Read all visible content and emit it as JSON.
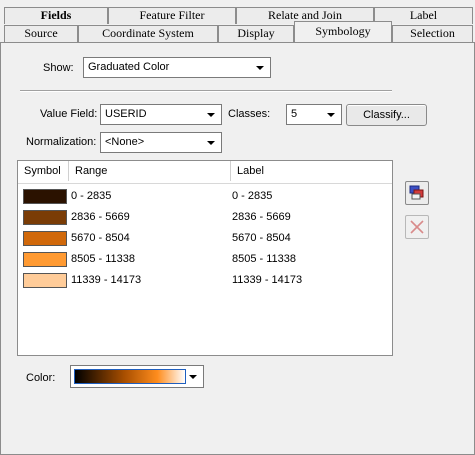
{
  "tabs_top": [
    "Fields",
    "Feature Filter",
    "Relate and Join",
    "Label"
  ],
  "tabs_bottom": [
    "Source",
    "Coordinate System",
    "Display",
    "Symbology",
    "Selection"
  ],
  "show": {
    "label": "Show:",
    "value": "Graduated Color"
  },
  "value_field": {
    "label": "Value Field:",
    "value": "USERID"
  },
  "classes": {
    "label": "Classes:",
    "value": "5"
  },
  "classify_button": "Classify...",
  "normalization": {
    "label": "Normalization:",
    "value": "<None>"
  },
  "table": {
    "headers": {
      "symbol": "Symbol",
      "range": "Range",
      "label": "Label"
    },
    "rows": [
      {
        "color": "#2b1200",
        "range": "0 - 2835",
        "label": "0 - 2835"
      },
      {
        "color": "#7a3c06",
        "range": "2836 - 5669",
        "label": "2836 - 5669"
      },
      {
        "color": "#d0680a",
        "range": "5670 - 8504",
        "label": "5670 - 8504"
      },
      {
        "color": "#ff9a32",
        "range": "8505 - 11338",
        "label": "8505 - 11338"
      },
      {
        "color": "#ffcc99",
        "range": "11339 - 14173",
        "label": "11339 - 14173"
      }
    ]
  },
  "color": {
    "label": "Color:"
  },
  "icons": {
    "properties": "symbol-properties-icon",
    "remove": "remove-x-icon"
  }
}
